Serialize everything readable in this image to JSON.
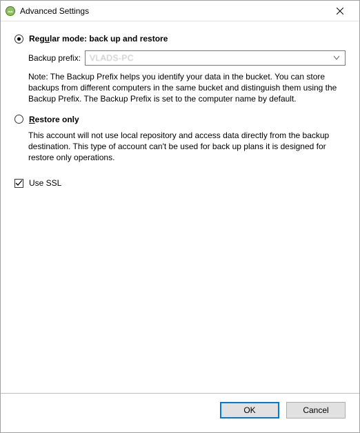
{
  "window": {
    "title": "Advanced Settings"
  },
  "options": {
    "regular": {
      "label_pre": "Reg",
      "label_u": "u",
      "label_post": "lar mode: back up and restore",
      "selected": true,
      "prefix_label": "Backup prefix:",
      "prefix_value": "VLADS-PC",
      "note": "Note: The Backup Prefix helps you identify your data in the bucket. You can store backups from different computers in the same bucket and distinguish them using the Backup Prefix. The Backup Prefix is set to the computer name by default."
    },
    "restore": {
      "label_u": "R",
      "label_post": "estore only",
      "selected": false,
      "note": "This account will not use local repository and access data directly from the backup destination. This type of account can't be used for back up plans it is designed for restore only operations."
    }
  },
  "ssl": {
    "label": "Use SSL",
    "checked": true
  },
  "buttons": {
    "ok": "OK",
    "cancel": "Cancel"
  }
}
